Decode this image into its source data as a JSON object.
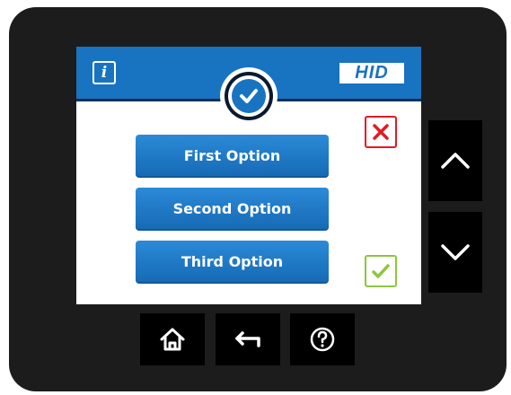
{
  "header": {
    "info_label": "i",
    "brand": "HID"
  },
  "options": [
    {
      "label": "First Option"
    },
    {
      "label": "Second Option"
    },
    {
      "label": "Third Option"
    }
  ],
  "icons": {
    "status": "check-circle-icon",
    "cancel": "close-icon",
    "confirm": "check-icon",
    "up": "chevron-up-icon",
    "down": "chevron-down-icon",
    "home": "home-icon",
    "back": "back-arrow-icon",
    "help": "help-icon"
  },
  "colors": {
    "accent": "#1873c1",
    "cancel": "#e01b24",
    "confirm": "#8cc63f",
    "bezel": "#1c1c1c"
  }
}
